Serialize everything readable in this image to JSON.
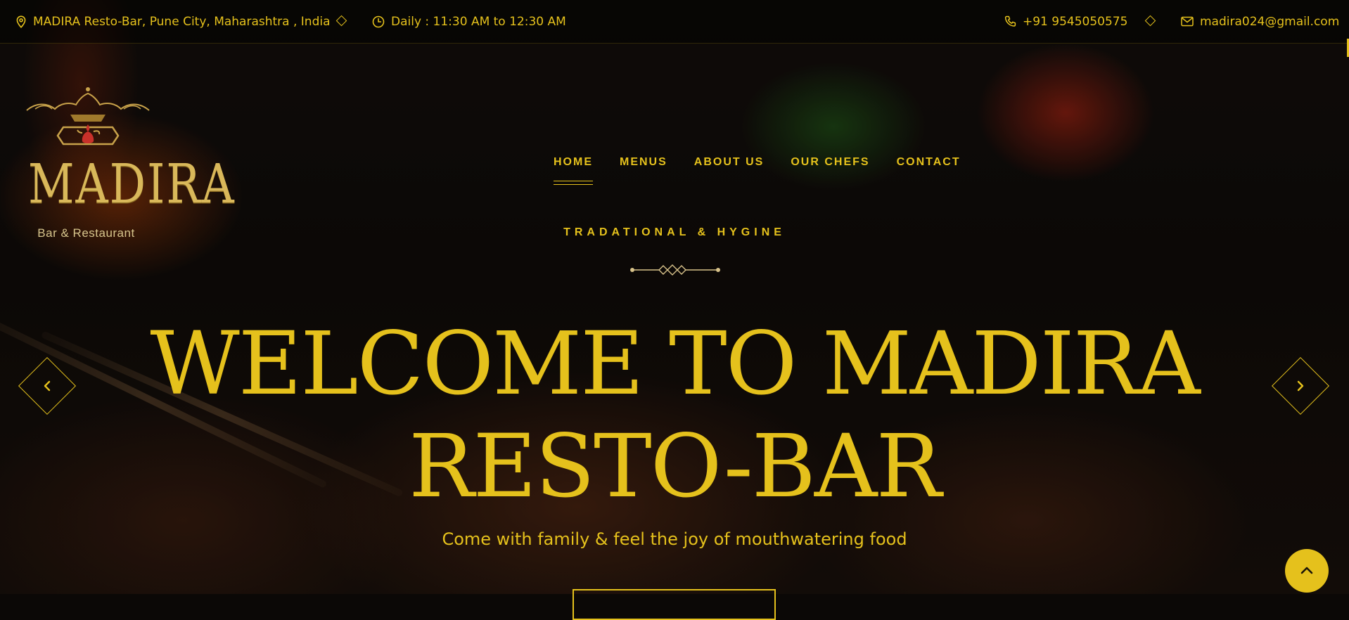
{
  "topbar": {
    "address": "MADIRA Resto-Bar, Pune City, Maharashtra , India",
    "hours": "Daily : 11:30 AM to 12:30 AM",
    "phone": "+91 9545050575",
    "email": "madira024@gmail.com"
  },
  "brand": {
    "name": "MADIRA",
    "subtitle": "Bar & Restaurant"
  },
  "nav": {
    "items": [
      {
        "label": "HOME",
        "active": true
      },
      {
        "label": "MENUS",
        "active": false
      },
      {
        "label": "ABOUT US",
        "active": false
      },
      {
        "label": "OUR CHEFS",
        "active": false
      },
      {
        "label": "CONTACT",
        "active": false
      }
    ]
  },
  "hero": {
    "subtitle": "TRADATIONAL & HYGINE",
    "headline_line1": "WELCOME TO MADIRA",
    "headline_line2": "RESTO-BAR",
    "tagline": "Come with family & feel the joy of mouthwatering food"
  },
  "icons": {
    "address": "map-pin-icon",
    "hours": "clock-icon",
    "phone": "phone-icon",
    "email": "mail-icon",
    "prev": "chevron-left-icon",
    "next": "chevron-right-icon",
    "top": "chevron-up-icon"
  },
  "colors": {
    "accent": "#e5c11c",
    "background": "#0b0806"
  }
}
